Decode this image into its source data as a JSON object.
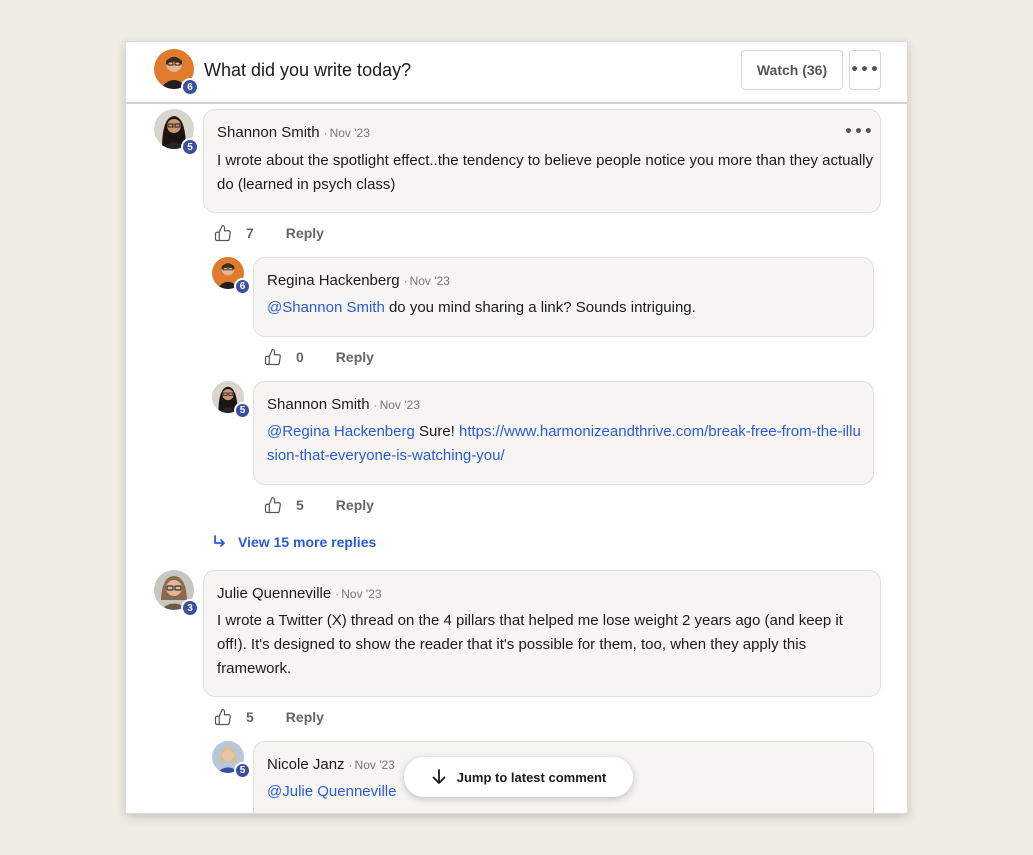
{
  "header": {
    "title": "What did you write today?",
    "watch_label": "Watch (36)",
    "more_label": "•••",
    "avatar_badge": "6"
  },
  "comments": [
    {
      "author": "Shannon Smith",
      "date": "Nov '23",
      "badge": "5",
      "body": "I wrote about the spotlight effect..the tendency to believe people notice you more than they actually do (learned in psych class)",
      "more_label": "•••",
      "likes": "7",
      "reply_label": "Reply"
    },
    {
      "author": "Regina Hackenberg",
      "date": "Nov '23",
      "badge": "6",
      "mention": "@Shannon Smith",
      "body": " do you mind sharing a link? Sounds intriguing.",
      "likes": "0",
      "reply_label": "Reply"
    },
    {
      "author": "Shannon Smith",
      "date": "Nov '23",
      "badge": "5",
      "mention": "@Regina Hackenberg",
      "body": " Sure! ",
      "link": "https://www.harmonizeandthrive.com/break-free-from-the-illusion-that-everyone-is-watching-you/",
      "likes": "5",
      "reply_label": "Reply"
    },
    {
      "author": "Julie Quenneville",
      "date": "Nov '23",
      "badge": "3",
      "body": "I wrote a Twitter (X) thread on the 4 pillars that helped me lose weight 2 years ago (and keep it off!). It's designed to show the reader that it's possible for them, too, when they apply this framework.",
      "likes": "5",
      "reply_label": "Reply"
    },
    {
      "author": "Nicole Janz",
      "date": "Nov '23",
      "badge": "5",
      "mention": "@Julie Quenneville",
      "body": ""
    }
  ],
  "view_more_label": "View 15 more replies",
  "jump_label": "Jump to latest comment",
  "colors": {
    "accent": "#2a5bd7",
    "badge": "#3b4fa0",
    "background": "#efede3"
  }
}
